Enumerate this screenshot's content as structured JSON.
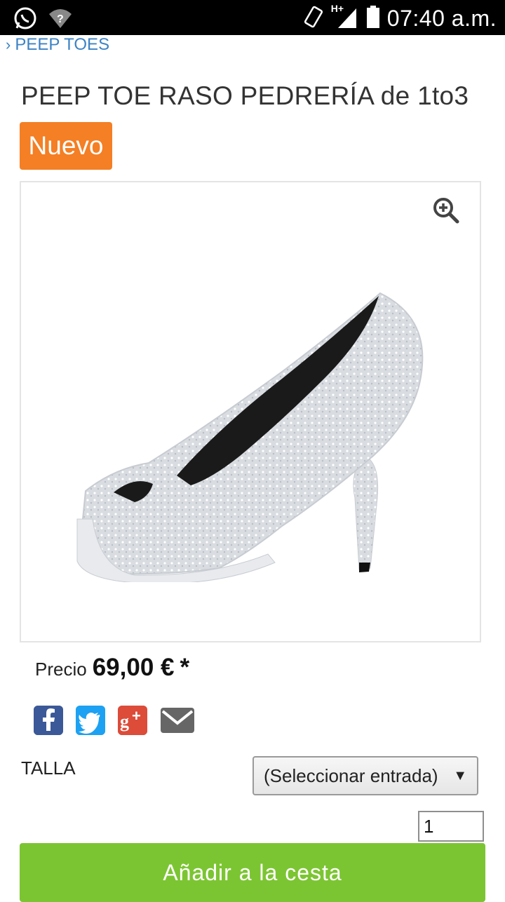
{
  "status_bar": {
    "time": "07:40 a.m.",
    "network_label": "H+",
    "icons": [
      "whatsapp-icon",
      "wifi-question-icon",
      "rotate-icon",
      "signal-icon",
      "battery-icon"
    ]
  },
  "breadcrumb": {
    "label": "PEEP TOES"
  },
  "product": {
    "title": "PEEP TOE RASO PEDRERÍA de 1to3",
    "badge": "Nuevo",
    "image_alt": "silver jeweled peep toe high heel shoe",
    "price_label": "Precio",
    "price_value": "69,00 €",
    "price_note": "*"
  },
  "share": {
    "icons": [
      "facebook-icon",
      "twitter-icon",
      "google-plus-icon",
      "email-icon"
    ]
  },
  "options": {
    "talla_label": "TALLA",
    "talla_selected": "(Seleccionar entrada)",
    "quantity": "1"
  },
  "actions": {
    "add_to_cart": "Añadir a la cesta"
  },
  "colors": {
    "badge": "#f47f24",
    "cart_button": "#7cc532",
    "link": "#3d83c4"
  }
}
